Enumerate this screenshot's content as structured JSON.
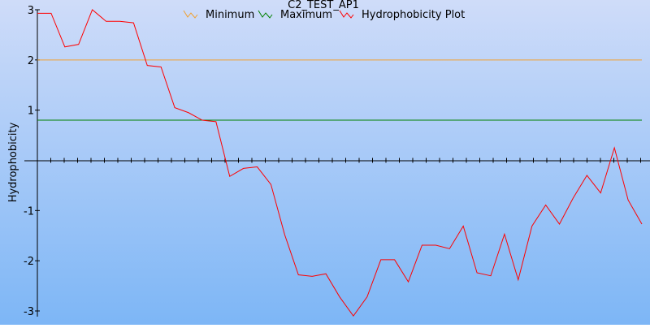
{
  "chart_data": {
    "type": "line",
    "title": "C2_TEST_AP1",
    "ylabel": "Hydrophobicity",
    "xlabel": "",
    "ylim": [
      -3,
      3
    ],
    "y_ticks": [
      -3,
      -2,
      -1,
      1,
      2,
      3
    ],
    "grid": false,
    "legend_position": "top-center",
    "series": [
      {
        "name": "Minimum",
        "color": "#F0A030",
        "values": [
          2,
          2
        ]
      },
      {
        "name": "Maximum",
        "color": "#008000",
        "values": [
          0.8,
          0.8
        ]
      },
      {
        "name": "Hydrophobicity Plot",
        "color": "#FF0000",
        "values": [
          2.93,
          2.93,
          2.26,
          2.31,
          3.0,
          2.77,
          2.77,
          2.74,
          1.89,
          1.86,
          1.05,
          0.95,
          0.8,
          0.77,
          -0.32,
          -0.16,
          -0.13,
          -0.48,
          -1.48,
          -2.28,
          -2.31,
          -2.26,
          -2.72,
          -3.1,
          -2.72,
          -1.98,
          -1.98,
          -2.42,
          -1.69,
          -1.69,
          -1.76,
          -1.31,
          -2.24,
          -2.3,
          -1.47,
          -2.38,
          -1.31,
          -0.89,
          -1.27,
          -0.75,
          -0.3,
          -0.65,
          0.25,
          -0.79,
          -1.27
        ]
      }
    ]
  }
}
